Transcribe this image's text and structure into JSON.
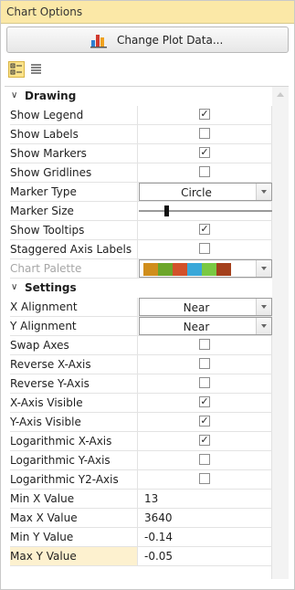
{
  "panel": {
    "title": "Chart Options"
  },
  "toolbar": {
    "change_plot_label": "Change Plot Data..."
  },
  "categories": {
    "drawing": "Drawing",
    "settings": "Settings"
  },
  "drawing_rows": [
    {
      "name": "Show Legend",
      "type": "checkbox",
      "checked": true
    },
    {
      "name": "Show Labels",
      "type": "checkbox",
      "checked": false
    },
    {
      "name": "Show Markers",
      "type": "checkbox",
      "checked": true
    },
    {
      "name": "Show Gridlines",
      "type": "checkbox",
      "checked": false
    },
    {
      "name": "Marker Type",
      "type": "combo",
      "value": "Circle"
    },
    {
      "name": "Marker Size",
      "type": "slider",
      "level": 0.2
    },
    {
      "name": "Show Tooltips",
      "type": "checkbox",
      "checked": true
    },
    {
      "name": "Staggered Axis Labels",
      "type": "checkbox",
      "checked": false
    },
    {
      "name": "Chart Palette",
      "type": "palette",
      "disabled": true,
      "colors": [
        "#d08e1c",
        "#6ca62a",
        "#d2512a",
        "#3aa8d9",
        "#7ac943",
        "#a4401c"
      ]
    }
  ],
  "settings_rows": [
    {
      "name": "X Alignment",
      "type": "combo",
      "value": "Near"
    },
    {
      "name": "Y Alignment",
      "type": "combo",
      "value": "Near"
    },
    {
      "name": "Swap Axes",
      "type": "checkbox",
      "checked": false
    },
    {
      "name": "Reverse X-Axis",
      "type": "checkbox",
      "checked": false
    },
    {
      "name": "Reverse Y-Axis",
      "type": "checkbox",
      "checked": false
    },
    {
      "name": "X-Axis Visible",
      "type": "checkbox",
      "checked": true
    },
    {
      "name": "Y-Axis Visible",
      "type": "checkbox",
      "checked": true
    },
    {
      "name": "Logarithmic X-Axis",
      "type": "checkbox",
      "checked": true
    },
    {
      "name": "Logarithmic Y-Axis",
      "type": "checkbox",
      "checked": false
    },
    {
      "name": "Logarithmic Y2-Axis",
      "type": "checkbox",
      "checked": false
    },
    {
      "name": "Min X Value",
      "type": "text",
      "value": "13"
    },
    {
      "name": "Max X Value",
      "type": "text",
      "value": "3640"
    },
    {
      "name": "Min Y Value",
      "type": "text",
      "value": "-0.14"
    },
    {
      "name": "Max Y Value",
      "type": "text",
      "value": "-0.05",
      "selected": true
    }
  ],
  "icons": {
    "change_plot": "bar-chart-icon",
    "categorized_view": "categorized-view-icon",
    "alphabetical_view": "list-view-icon"
  },
  "colors": {
    "title_bg": "#fbe8a7",
    "selected_row": "#fdf1cf",
    "toolbar_selected": "#fbe38a"
  }
}
